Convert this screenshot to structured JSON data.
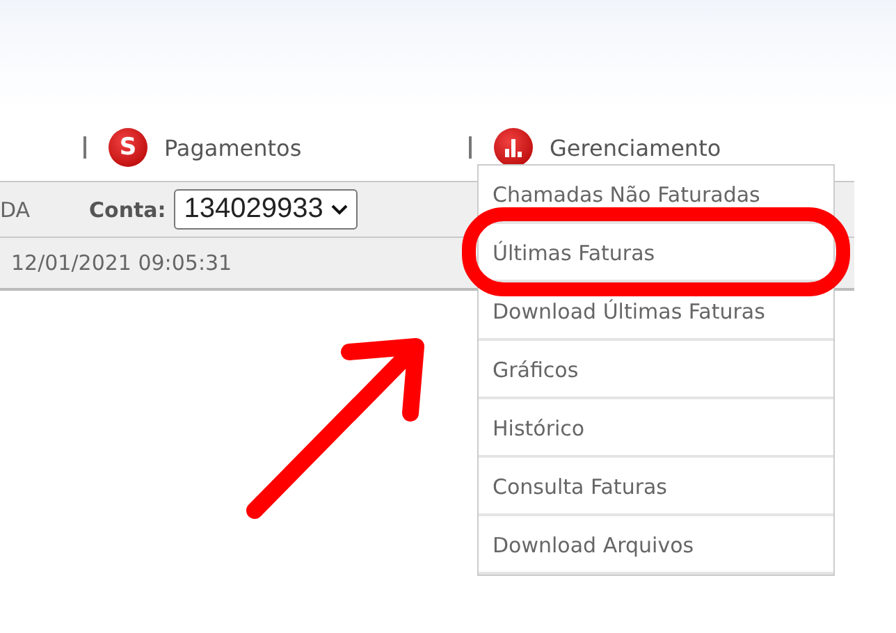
{
  "nav": [
    {
      "kind": "letter",
      "badge": "S",
      "label": "Pagamentos"
    },
    {
      "kind": "chart",
      "label": "Gerenciamento"
    }
  ],
  "account_bar": {
    "partial_label": "DA",
    "label": "Conta:",
    "value": "134029933"
  },
  "info_row": {
    "datetime": "12/01/2021 09:05:31"
  },
  "menu": [
    {
      "label": "Chamadas Não Faturadas",
      "highlighted": false
    },
    {
      "label": "Últimas Faturas",
      "highlighted": true
    },
    {
      "label": "Download Últimas Faturas",
      "highlighted": false
    },
    {
      "label": "Gráficos",
      "highlighted": false
    },
    {
      "label": "Histórico",
      "highlighted": false
    },
    {
      "label": "Consulta Faturas",
      "highlighted": false
    },
    {
      "label": "Download Arquivos",
      "highlighted": false
    }
  ],
  "annotations": [
    {
      "kind": "arrow"
    }
  ]
}
